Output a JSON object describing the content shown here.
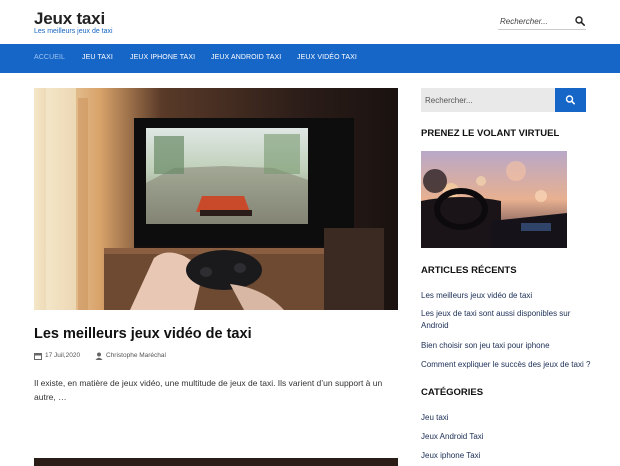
{
  "header": {
    "site_title": "Jeux taxi",
    "tagline": "Les meilleurs jeux de taxi",
    "search_placeholder": "Rechercher...",
    "search_icon": "search-icon"
  },
  "nav": {
    "items": [
      {
        "label": "ACCUEIL",
        "active": true
      },
      {
        "label": "JEU TAXI",
        "active": false
      },
      {
        "label": "JEUX IPHONE TAXI",
        "active": false
      },
      {
        "label": "JEUX ANDROID TAXI",
        "active": false
      },
      {
        "label": "JEUX VIDÉO TAXI",
        "active": false
      }
    ]
  },
  "post": {
    "title": "Les meilleurs jeux vidéo de taxi",
    "date": "17 Juil,2020",
    "author": "Christophe Maréchal",
    "excerpt": "Il existe, en matière de jeux vidéo, une multitude de jeux de taxi. Ils varient d’un support à un autre, …"
  },
  "sidebar": {
    "search_placeholder": "Rechercher...",
    "widget_image_title": "PRENEZ LE VOLANT VIRTUEL",
    "recent_title": "ARTICLES RÉCENTS",
    "recent_posts": [
      "Les meilleurs jeux vidéo de taxi",
      "Les jeux de taxi sont aussi disponibles sur Android",
      "Bien choisir son jeu taxi pour iphone",
      "Comment expliquer le succès des jeux de taxi ?"
    ],
    "categories_title": "CATÉGORIES",
    "categories": [
      "Jeu taxi",
      "Jeux Android Taxi",
      "Jeux iphone Taxi"
    ]
  },
  "colors": {
    "accent": "#1666c8",
    "nav_active": "#9cc3f0",
    "link": "#1b2e55"
  }
}
